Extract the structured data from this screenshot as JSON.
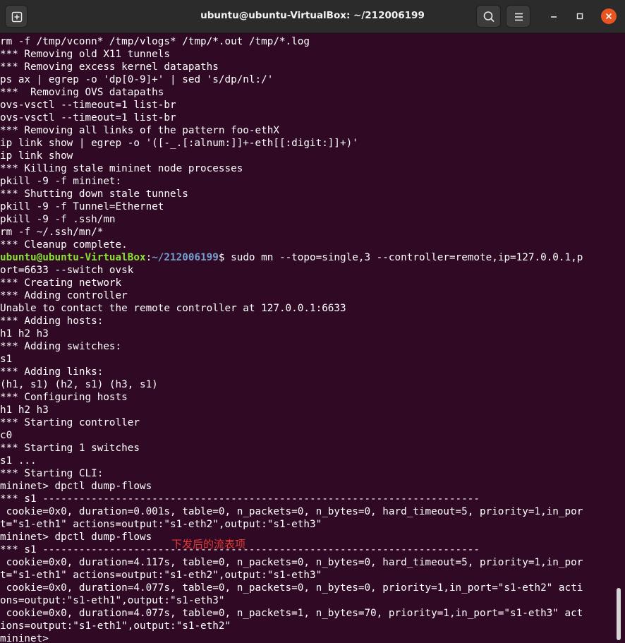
{
  "window": {
    "title": "ubuntu@ubuntu-VirtualBox: ~/212006199"
  },
  "icons": {
    "new_tab": "new-tab-icon",
    "search": "search-icon",
    "menu": "hamburger-menu-icon",
    "minimize": "minimize-icon",
    "maximize": "maximize-icon",
    "close": "close-icon"
  },
  "colors": {
    "terminal_bg": "#300a24",
    "prompt_user": "#8ae234",
    "prompt_path": "#729fcf",
    "close_button": "#e95420",
    "annotation": "#e53935"
  },
  "terminal": {
    "lines": [
      "rm -f /tmp/vconn* /tmp/vlogs* /tmp/*.out /tmp/*.log",
      "*** Removing old X11 tunnels",
      "*** Removing excess kernel datapaths",
      "ps ax | egrep -o 'dp[0-9]+' | sed 's/dp/nl:/'",
      "***  Removing OVS datapaths",
      "ovs-vsctl --timeout=1 list-br",
      "ovs-vsctl --timeout=1 list-br",
      "*** Removing all links of the pattern foo-ethX",
      "ip link show | egrep -o '([-_.[:alnum:]]+-eth[[:digit:]]+)'",
      "ip link show",
      "*** Killing stale mininet node processes",
      "pkill -9 -f mininet:",
      "*** Shutting down stale tunnels",
      "pkill -9 -f Tunnel=Ethernet",
      "pkill -9 -f .ssh/mn",
      "rm -f ~/.ssh/mn/*",
      "*** Cleanup complete."
    ],
    "prompt": {
      "user_host": "ubuntu@ubuntu-VirtualBox",
      "colon": ":",
      "path": "~/212006199",
      "dollar": "$",
      "command": " sudo mn --topo=single,3 --controller=remote,ip=127.0.0.1,p"
    },
    "lines_after": [
      "ort=6633 --switch ovsk",
      "*** Creating network",
      "*** Adding controller",
      "Unable to contact the remote controller at 127.0.0.1:6633",
      "*** Adding hosts:",
      "h1 h2 h3",
      "*** Adding switches:",
      "s1",
      "*** Adding links:",
      "(h1, s1) (h2, s1) (h3, s1)",
      "*** Configuring hosts",
      "h1 h2 h3",
      "*** Starting controller",
      "c0",
      "*** Starting 1 switches",
      "s1 ...",
      "*** Starting CLI:",
      "mininet> dpctl dump-flows",
      "*** s1 ------------------------------------------------------------------------",
      " cookie=0x0, duration=0.001s, table=0, n_packets=0, n_bytes=0, hard_timeout=5, priority=1,in_por",
      "t=\"s1-eth1\" actions=output:\"s1-eth2\",output:\"s1-eth3\"",
      "mininet> dpctl dump-flows",
      "*** s1 ------------------------------------------------------------------------",
      " cookie=0x0, duration=4.117s, table=0, n_packets=0, n_bytes=0, hard_timeout=5, priority=1,in_por",
      "t=\"s1-eth1\" actions=output:\"s1-eth2\",output:\"s1-eth3\"",
      " cookie=0x0, duration=4.077s, table=0, n_packets=0, n_bytes=0, priority=1,in_port=\"s1-eth2\" acti",
      "ons=output:\"s1-eth1\",output:\"s1-eth3\"",
      " cookie=0x0, duration=4.077s, table=0, n_packets=1, n_bytes=70, priority=1,in_port=\"s1-eth3\" act",
      "ions=output:\"s1-eth1\",output:\"s1-eth2\"",
      "mininet>"
    ],
    "annotation": "下发后的流表项"
  }
}
